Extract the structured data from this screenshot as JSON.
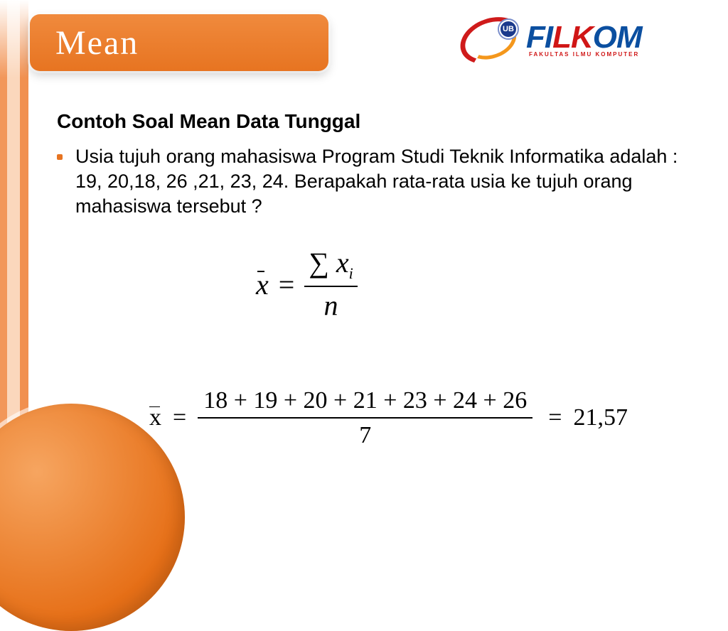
{
  "title": "Mean",
  "logo": {
    "badge": "UB",
    "word_fi": "FI",
    "word_lk": "LK",
    "word_om": "OM",
    "subtitle": "FAKULTAS ILMU KOMPUTER"
  },
  "subheading": "Contoh Soal Mean Data Tunggal",
  "body": "Usia tujuh orang mahasiswa Program Studi Teknik Informatika adalah : 19, 20,18, 26 ,21, 23, 24. Berapakah rata-rata usia ke tujuh orang mahasiswa tersebut ?",
  "formula1": {
    "lhs_var": "x",
    "eq": "=",
    "sigma": "∑",
    "num_var": "x",
    "num_sub": "i",
    "den": "n"
  },
  "formula2": {
    "lhs_var": "x",
    "eq1": "=",
    "numerator": "18 + 19 + 20 + 21 + 23 + 24 + 26",
    "denominator": "7",
    "eq2": "=",
    "result": "21,57"
  }
}
